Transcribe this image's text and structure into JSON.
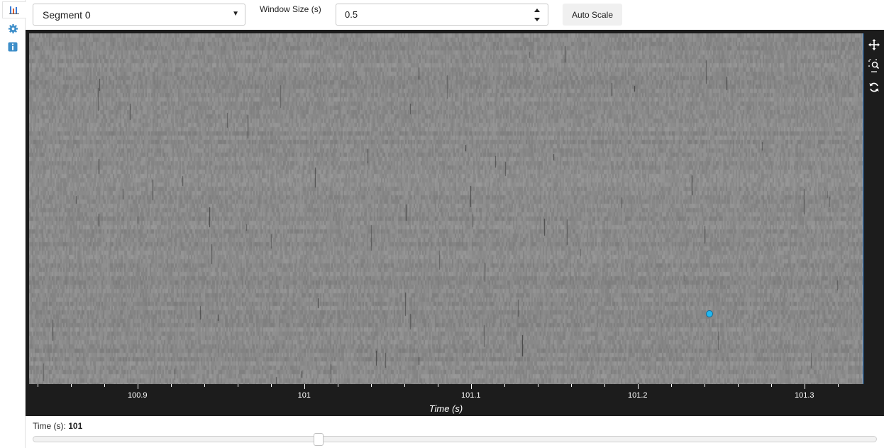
{
  "sidebar": {
    "icons": [
      {
        "name": "chart-icon",
        "active": true
      },
      {
        "name": "gear-icon",
        "active": false
      },
      {
        "name": "info-icon",
        "active": false
      }
    ]
  },
  "toolbar": {
    "segment_select": {
      "value": "Segment 0",
      "options": [
        "Segment 0"
      ]
    },
    "window_size_label": "Window Size (s)",
    "window_size_value": "0.5",
    "auto_scale_label": "Auto Scale"
  },
  "plot": {
    "x_axis_title": "Time (s)",
    "x_range": [
      100.835,
      101.335
    ],
    "major_ticks": [
      {
        "value": 100.9,
        "label": "100.9"
      },
      {
        "value": 101.0,
        "label": "101"
      },
      {
        "value": 101.1,
        "label": "101.1"
      },
      {
        "value": 101.2,
        "label": "101.2"
      },
      {
        "value": 101.3,
        "label": "101.3"
      }
    ],
    "minor_tick_step": 0.02,
    "cursor_time": 101.243,
    "cursor_row_fraction": 0.8,
    "tools": [
      "pan-icon",
      "box-zoom-icon",
      "reset-icon"
    ],
    "colors": {
      "background": "#1c1c1c",
      "heatmap_base": "#8c8c8c",
      "cursor": "#22b8f0",
      "accent": "#4aa3ff"
    }
  },
  "time_slider": {
    "label": "Time (s):",
    "value": "101",
    "min": 0,
    "max": 300,
    "current": 101
  }
}
